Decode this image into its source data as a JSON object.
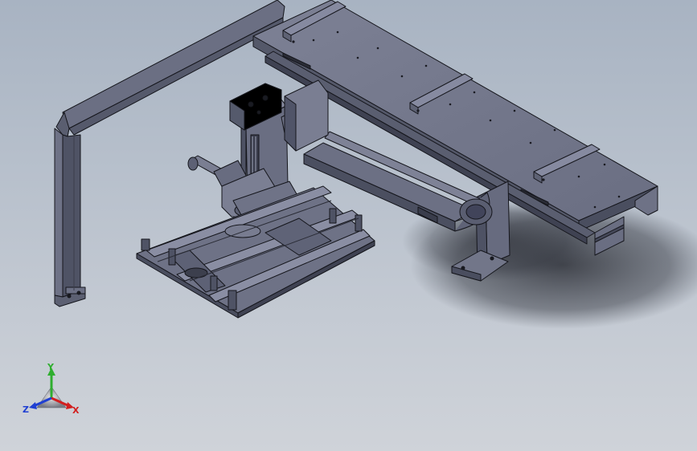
{
  "viewport": {
    "background_top": "#a8b3c2",
    "background_bottom": "#cfd3d9",
    "model_shade_light": "#7b7f93",
    "model_shade_mid": "#5f6377",
    "model_shade_dark": "#3c3f4d",
    "edge_color": "#15161c"
  },
  "triad": {
    "x_label": "X",
    "y_label": "Y",
    "z_label": "Z",
    "x_color": "#d21f1f",
    "y_color": "#2fae2f",
    "z_color": "#1f3fd2"
  }
}
